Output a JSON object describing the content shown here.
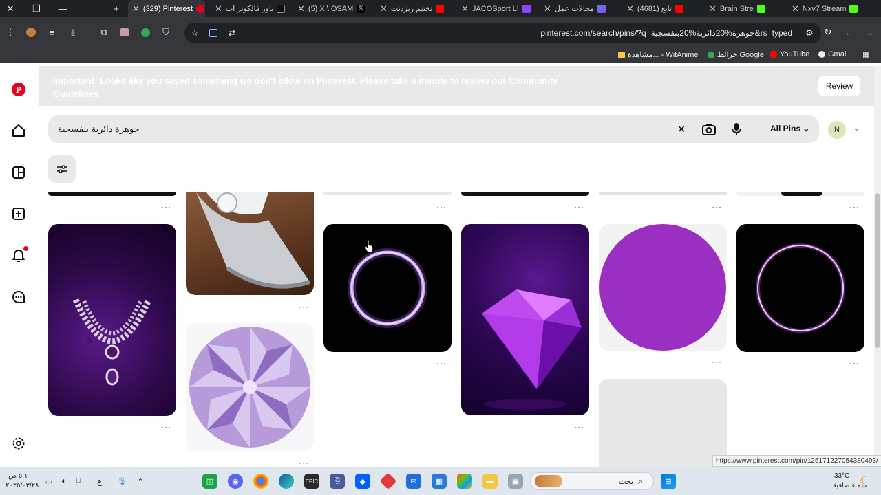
{
  "browser": {
    "tabs": [
      {
        "label": "(329) Pinterest",
        "active": true
      },
      {
        "label": "باور فالكونز اب"
      },
      {
        "label": "(5) X \\ OSAM"
      },
      {
        "label": "تختيم ريزدنت"
      },
      {
        "label": "JACOSport LI"
      },
      {
        "label": "مجالات عمل"
      },
      {
        "label": "(4681) تابع"
      },
      {
        "label": "Brain Stre"
      },
      {
        "label": "Nxv7 Stream"
      }
    ],
    "url": "pinterest.com/search/pins/?q=جوهرة%20دائرية%20بنفسجية&rs=typed",
    "bookmarks": [
      {
        "label": "Gmail"
      },
      {
        "label": "YouTube"
      },
      {
        "label": "خرائط Google"
      },
      {
        "label": "مشاهدة... - WitAnime"
      }
    ]
  },
  "pinterest": {
    "banner": {
      "text": "Important: Looks like you saved something we don't allow on Pinterest. Please take a minute to review our Community Guidelines.",
      "review_label": "Review"
    },
    "search": {
      "query": "جوهرة دائرية بنفسجية",
      "scope": "All Pins"
    },
    "avatar_initial": "N",
    "more_label": "···",
    "pins": [
      {
        "subject": "purple-gem-necklace"
      },
      {
        "subject": "diamond-ring"
      },
      {
        "subject": "violet-crystal-gem"
      },
      {
        "subject": "purple-neon-ring-glow"
      },
      {
        "subject": "purple-diamond"
      },
      {
        "subject": "purple-circle"
      },
      {
        "subject": "purple-neon-ring-outline"
      },
      {
        "subject": "loading-placeholder"
      }
    ]
  },
  "status_url": "https://www.pinterest.com/pin/126171227054380493/",
  "taskbar": {
    "weather_temp": "33°C",
    "weather_desc": "سماء صافية",
    "search_label": "بحث",
    "time": "٥:١٠ ص",
    "date": "٢٠٢٥/٠٣/٢٨",
    "lang": "ع"
  },
  "colors": {
    "pinterest_red": "#e60023",
    "banner_bg": "#e9e9e9",
    "chrome_dark": "#202124",
    "chrome_toolbar": "#35363a"
  }
}
